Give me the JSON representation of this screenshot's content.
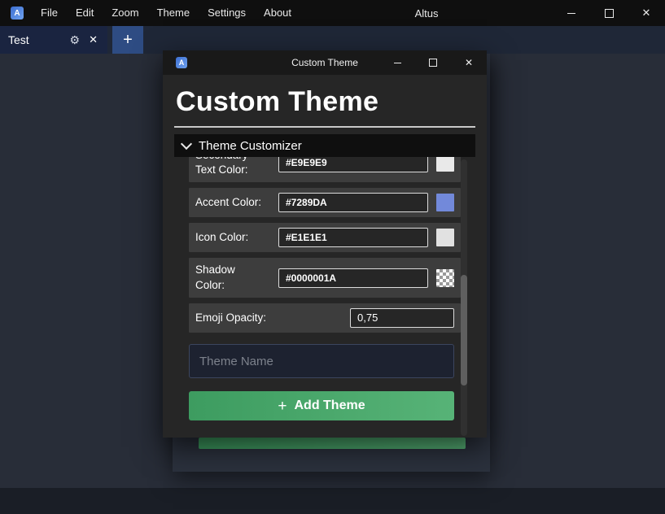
{
  "titlebar": {
    "app_title": "Altus",
    "menu": [
      "File",
      "Edit",
      "Zoom",
      "Theme",
      "Settings",
      "About"
    ]
  },
  "tabbar": {
    "active_tab_label": "Test"
  },
  "icons": {
    "gear": "⚙",
    "close": "✕",
    "plus": "+",
    "app_logo_letter": "A"
  },
  "dialog": {
    "window_title": "Custom Theme",
    "heading": "Custom Theme",
    "section_title": "Theme Customizer",
    "fields": [
      {
        "label": "Secondary Text Color:",
        "value": "#E9E9E9",
        "swatch_color": "#E9E9E9"
      },
      {
        "label": "Accent Color:",
        "value": "#7289DA",
        "swatch_color": "#7289DA"
      },
      {
        "label": "Icon Color:",
        "value": "#E1E1E1",
        "swatch_color": "#E1E1E1"
      },
      {
        "label": "Shadow Color:",
        "value": "#0000001A",
        "swatch_color": "checker"
      },
      {
        "label": "Emoji Opacity:",
        "value": "0,75"
      }
    ],
    "theme_name_placeholder": "Theme Name",
    "add_theme_button": "Add Theme"
  },
  "colors": {
    "add_theme_gradient": "linear-gradient(90deg,#3d9c60,#57b377)",
    "accent_blue": "#7289DA",
    "plus_tab_blue": "#2e4c83"
  }
}
